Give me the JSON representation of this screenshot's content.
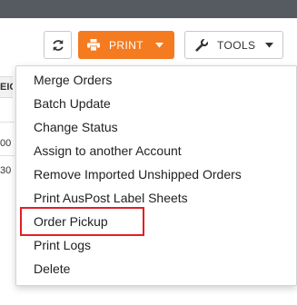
{
  "toolbar": {
    "refresh_icon": "refresh-icon",
    "print_label": "PRINT",
    "print_icon": "printer-icon",
    "tools_label": "TOOLS",
    "tools_icon": "wrench-icon",
    "accent_color": "#f47b20"
  },
  "background": {
    "column_header_fragment": "EIC",
    "row_fragments": [
      "00",
      "30"
    ]
  },
  "menu": {
    "items": [
      "Merge Orders",
      "Batch Update",
      "Change Status",
      "Assign to another Account",
      "Remove Imported Unshipped Orders",
      "Print AusPost Label Sheets",
      "Order Pickup",
      "Print Logs",
      "Delete"
    ],
    "highlighted_item": "Order Pickup",
    "highlight_color": "#e41e26"
  }
}
